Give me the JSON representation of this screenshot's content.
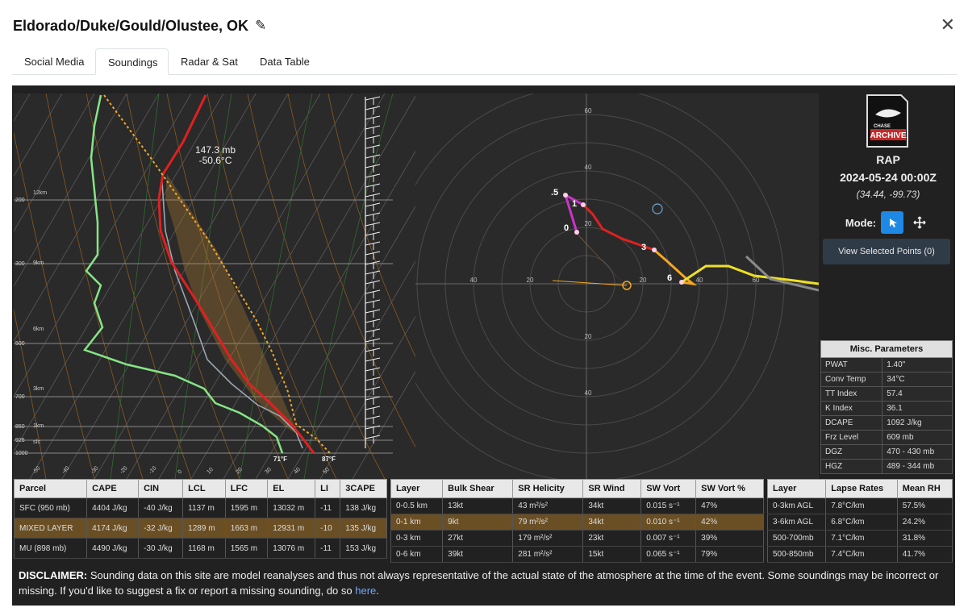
{
  "title": "Eldorado/Duke/Gould/Olustee, OK",
  "tabs": [
    {
      "label": "Social Media"
    },
    {
      "label": "Soundings"
    },
    {
      "label": "Radar & Sat"
    },
    {
      "label": "Data Table"
    }
  ],
  "icons": {
    "close": "close-icon",
    "edit": "pencil-icon",
    "mode_select": "pointer-icon",
    "mode_move": "move-icon"
  },
  "skewt": {
    "pressure_labels": [
      "200",
      "300",
      "500",
      "700",
      "850",
      "925",
      "1000"
    ],
    "height_labels": [
      "12km",
      "9km",
      "6km",
      "3km",
      "1km",
      "sfc"
    ],
    "temp_ticks": [
      "-50",
      "-40",
      "-30",
      "-20",
      "-10",
      "0",
      "10",
      "20",
      "30",
      "40",
      "50"
    ],
    "cursor_readout": {
      "pressure": "147.3 mb",
      "temp": "-50.6°C"
    },
    "sfc_dewpoint": "71°F",
    "sfc_temp": "87°F"
  },
  "hodograph": {
    "ring_labels": [
      "60",
      "40",
      "20",
      "20",
      "40",
      "60",
      "40",
      "20",
      "20",
      "40"
    ],
    "height_markers": [
      ".5",
      "1",
      "0",
      "3",
      "6"
    ]
  },
  "side": {
    "logo_text": [
      "CHASE",
      "ARCHIVE"
    ],
    "model": "RAP",
    "datetime": "2024-05-24 00:00Z",
    "coords": "(34.44, -99.73)",
    "mode_label": "Mode:",
    "view_button": "View Selected Points (0)"
  },
  "misc_params": {
    "header": "Misc. Parameters",
    "rows": [
      {
        "k": "PWAT",
        "v": "1.40\""
      },
      {
        "k": "Conv Temp",
        "v": "34°C"
      },
      {
        "k": "TT Index",
        "v": "57.4"
      },
      {
        "k": "K Index",
        "v": "36.1"
      },
      {
        "k": "DCAPE",
        "v": "1092 J/kg"
      },
      {
        "k": "Frz Level",
        "v": "609 mb"
      },
      {
        "k": "DGZ",
        "v": "470 - 430 mb"
      },
      {
        "k": "HGZ",
        "v": "489 - 344 mb"
      }
    ]
  },
  "parcel_table": {
    "headers": [
      "Parcel",
      "CAPE",
      "CIN",
      "LCL",
      "LFC",
      "EL",
      "LI",
      "3CAPE"
    ],
    "rows": [
      [
        "SFC (950 mb)",
        "4404 J/kg",
        "-40 J/kg",
        "1137 m",
        "1595 m",
        "13032 m",
        "-11",
        "138 J/kg"
      ],
      [
        "MIXED LAYER",
        "4174 J/kg",
        "-32 J/kg",
        "1289 m",
        "1663 m",
        "12931 m",
        "-10",
        "135 J/kg"
      ],
      [
        "MU (898 mb)",
        "4490 J/kg",
        "-30 J/kg",
        "1168 m",
        "1565 m",
        "13076 m",
        "-11",
        "153 J/kg"
      ]
    ]
  },
  "shear_table": {
    "headers": [
      "Layer",
      "Bulk Shear",
      "SR Helicity",
      "SR Wind",
      "SW Vort",
      "SW Vort %"
    ],
    "rows": [
      [
        "0-0.5 km",
        "13kt",
        "43 m²/s²",
        "34kt",
        "0.015 s⁻¹",
        "47%"
      ],
      [
        "0-1 km",
        "9kt",
        "79 m²/s²",
        "34kt",
        "0.010 s⁻¹",
        "42%"
      ],
      [
        "0-3 km",
        "27kt",
        "179 m²/s²",
        "23kt",
        "0.007 s⁻¹",
        "39%"
      ],
      [
        "0-6 km",
        "39kt",
        "281 m²/s²",
        "15kt",
        "0.065 s⁻¹",
        "79%"
      ]
    ]
  },
  "lapse_table": {
    "headers": [
      "Layer",
      "Lapse Rates",
      "Mean RH"
    ],
    "rows": [
      [
        "0-3km AGL",
        "7.8°C/km",
        "57.5%"
      ],
      [
        "3-6km AGL",
        "6.8°C/km",
        "24.2%"
      ],
      [
        "500-700mb",
        "7.1°C/km",
        "31.8%"
      ],
      [
        "500-850mb",
        "7.4°C/km",
        "41.7%"
      ]
    ]
  },
  "disclaimer": {
    "label": "DISCLAIMER:",
    "text": " Sounding data on this site are model reanalyses and thus not always representative of the actual state of the atmosphere at the time of the event. Some soundings may be incorrect or missing. If you'd like to suggest a fix or report a missing sounding, do so ",
    "link": "here",
    "end": "."
  },
  "colors": {
    "temp": "#e02020",
    "dewpoint": "#7ee07e",
    "parcel": "#f5a623",
    "hodo_0_1": "#cc33cc",
    "hodo_1_3": "#e02020",
    "hodo_3_6": "#f5a623",
    "hodo_6_9": "#f0e020",
    "selected": "#1e88e5"
  }
}
